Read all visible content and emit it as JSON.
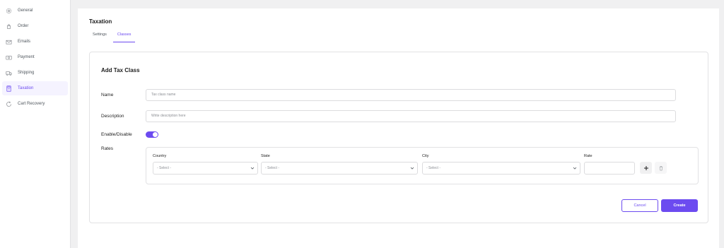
{
  "sidebar": {
    "items": [
      {
        "label": "General",
        "icon": "gear-icon"
      },
      {
        "label": "Order",
        "icon": "order-icon"
      },
      {
        "label": "Emails",
        "icon": "email-icon"
      },
      {
        "label": "Payment",
        "icon": "payment-icon"
      },
      {
        "label": "Shipping",
        "icon": "truck-icon"
      },
      {
        "label": "Taxation",
        "icon": "taxation-icon",
        "active": true
      },
      {
        "label": "Cart Recovery",
        "icon": "cart-recovery-icon"
      }
    ]
  },
  "header": {
    "title": "Taxation",
    "tabs": [
      {
        "label": "Settings"
      },
      {
        "label": "Classes",
        "active": true
      }
    ]
  },
  "form": {
    "title": "Add Tax Class",
    "name_label": "Name",
    "name_placeholder": "Tax class name",
    "description_label": "Description",
    "description_placeholder": "Write description here",
    "enable_label": "Enable/Disable",
    "enabled": true,
    "rates_label": "Rates",
    "rates": {
      "country_label": "Country",
      "country_value": "- Select -",
      "state_label": "State",
      "state_value": "- Select -",
      "city_label": "City",
      "city_value": "- Select -",
      "rate_label": "Rate",
      "rate_value": ""
    },
    "cancel_label": "Cancel",
    "create_label": "Create"
  },
  "colors": {
    "accent": "#6c4bf0",
    "accent_bg": "#f5f3ff",
    "border": "#e2e2e4",
    "page_bg": "#f0f0f1"
  }
}
